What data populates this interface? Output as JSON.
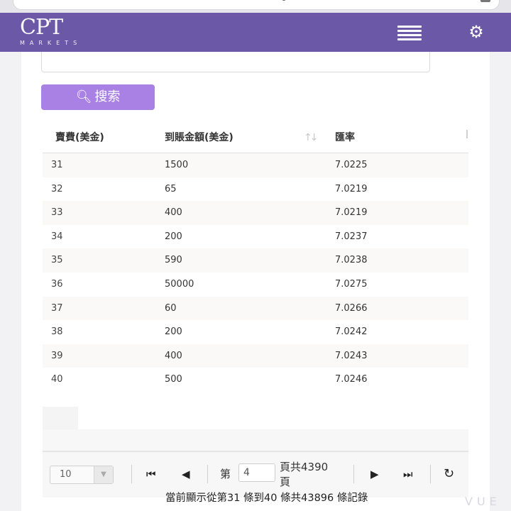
{
  "brand": {
    "logo_text": "CPT",
    "sub_text": "MARKETS"
  },
  "search": {
    "button_label": "搜索",
    "field_value": ""
  },
  "table": {
    "headers": [
      "賣費(美金)",
      "到賬金額(美金)",
      "匯率"
    ],
    "rows": [
      [
        "31",
        "1500",
        "7.0225"
      ],
      [
        "32",
        "65",
        "7.0219"
      ],
      [
        "33",
        "400",
        "7.0219"
      ],
      [
        "34",
        "200",
        "7.0237"
      ],
      [
        "35",
        "590",
        "7.0238"
      ],
      [
        "36",
        "50000",
        "7.0275"
      ],
      [
        "37",
        "60",
        "7.0266"
      ],
      [
        "38",
        "200",
        "7.0242"
      ],
      [
        "39",
        "400",
        "7.0243"
      ],
      [
        "40",
        "500",
        "7.0246"
      ]
    ]
  },
  "pager": {
    "page_size": "10",
    "page_prefix": "第",
    "current_page": "4",
    "page_suffix_line1": "頁共4390",
    "page_suffix_line2": "頁",
    "record_info": "當前顯示從第31 條到40 條共43896 條記錄"
  },
  "watermark": "VUE",
  "colors": {
    "navbar": "#6b58a7",
    "search_button": "#a980e3",
    "row_stripe": "#fbf8f8"
  },
  "icons": {
    "menu": "hamburger-icon",
    "settings": "gear-icon",
    "search": "magnifier-icon",
    "first": "first-page-icon",
    "prev": "prev-page-icon",
    "next": "next-page-icon",
    "last": "last-page-icon",
    "refresh": "refresh-icon"
  }
}
